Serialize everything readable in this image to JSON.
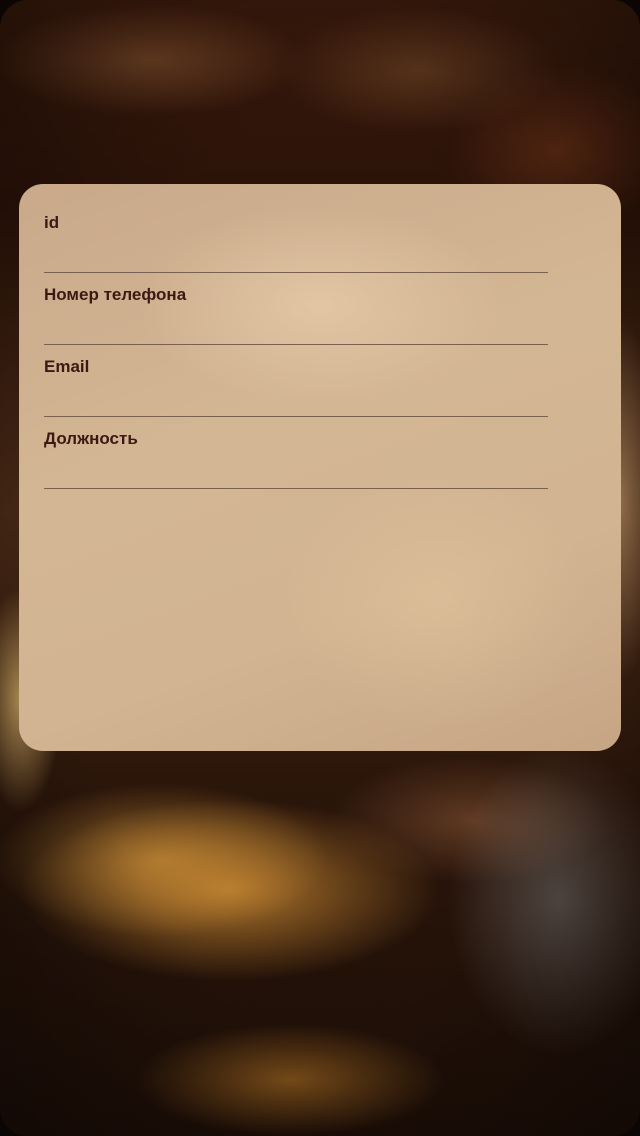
{
  "form": {
    "fields": [
      {
        "label": "id",
        "value": ""
      },
      {
        "label": "Номер телефона",
        "value": ""
      },
      {
        "label": "Email",
        "value": ""
      },
      {
        "label": "Должность",
        "value": ""
      }
    ]
  },
  "colors": {
    "label_text": "#3a1a12",
    "card_background": "#d2b492",
    "underline": "#7a6052"
  }
}
